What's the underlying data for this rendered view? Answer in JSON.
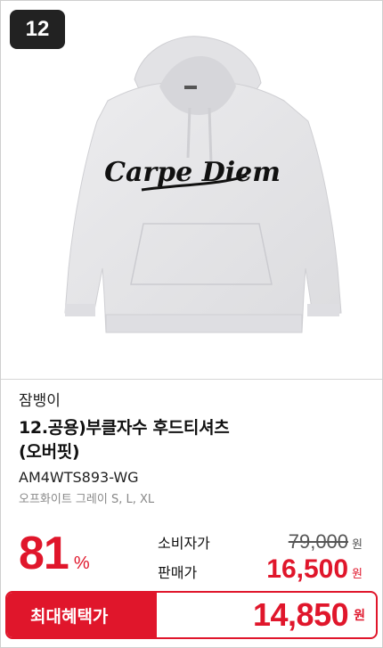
{
  "rank": "12",
  "product": {
    "brand": "잠뱅이",
    "name_line1": "12.공용)부클자수 후드티셔츠",
    "name_line2": "(오버핏)",
    "model": "AM4WTS893-WG",
    "option": "오프화이트 그레이 S, L, XL",
    "print_text": "Carpe Diem",
    "color": "#e8e8ea"
  },
  "pricing": {
    "discount_number": "81",
    "discount_unit": "%",
    "retail_label": "소비자가",
    "retail_price": "79,000",
    "sale_label": "판매가",
    "sale_price": "16,500",
    "currency": "원"
  },
  "max_benefit": {
    "label": "최대혜택가",
    "price": "14,850",
    "currency": "원"
  },
  "colors": {
    "accent": "#e0162b",
    "badge": "#222222"
  }
}
